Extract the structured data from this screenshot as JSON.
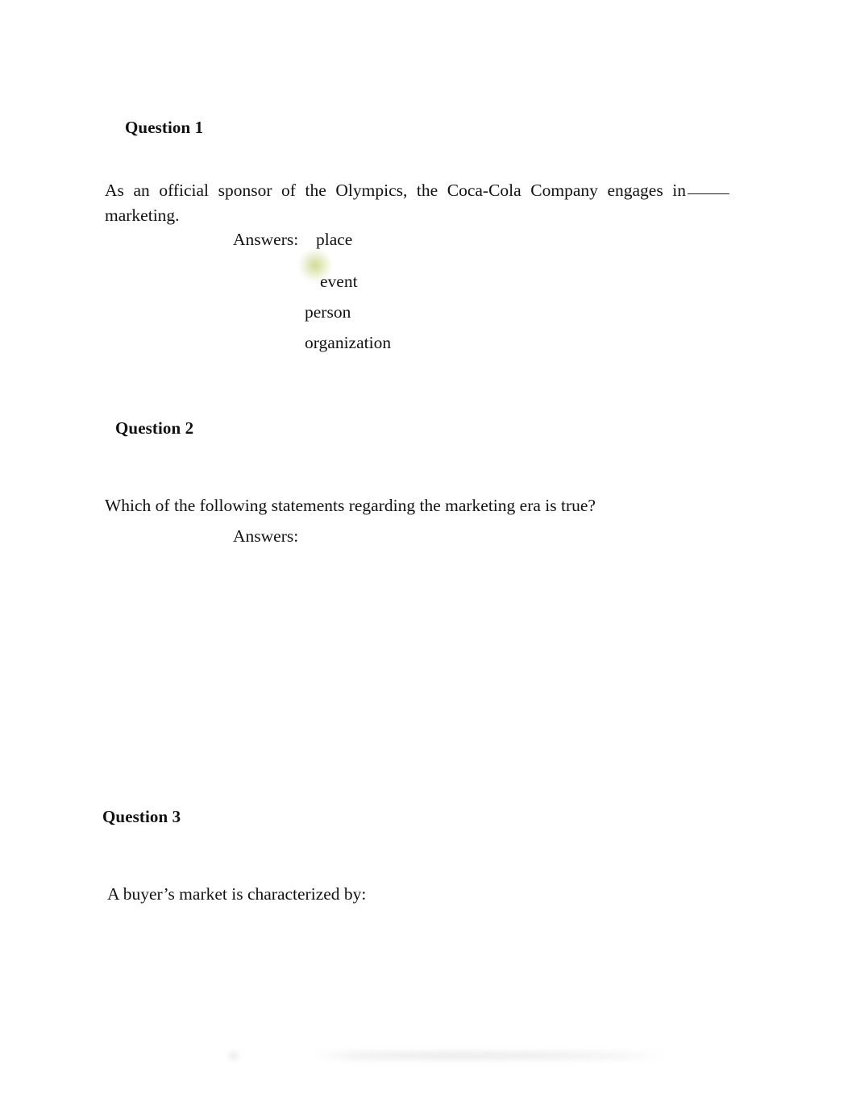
{
  "document": {
    "background_color": "#ffffff",
    "text_color": "#121212",
    "highlight_color": "#cdd88c"
  },
  "questions": [
    {
      "heading": "Question 1",
      "prompt_before_blank": "As an official sponsor of the Olympics, the Coca-Cola Company engages in",
      "prompt_after_blank": "marketing.",
      "answers_label": "Answers:",
      "options": [
        {
          "label": "place",
          "highlighted": false
        },
        {
          "label": "event",
          "highlighted": true
        },
        {
          "label": "person",
          "highlighted": false
        },
        {
          "label": "organization",
          "highlighted": false
        }
      ]
    },
    {
      "heading": "Question 2",
      "prompt": "Which of the following statements regarding the marketing era is true?",
      "answers_label": "Answers:",
      "options": []
    },
    {
      "heading": "Question 3",
      "prompt": "A buyer’s market is characterized by:",
      "answers_label": "",
      "options": []
    }
  ]
}
